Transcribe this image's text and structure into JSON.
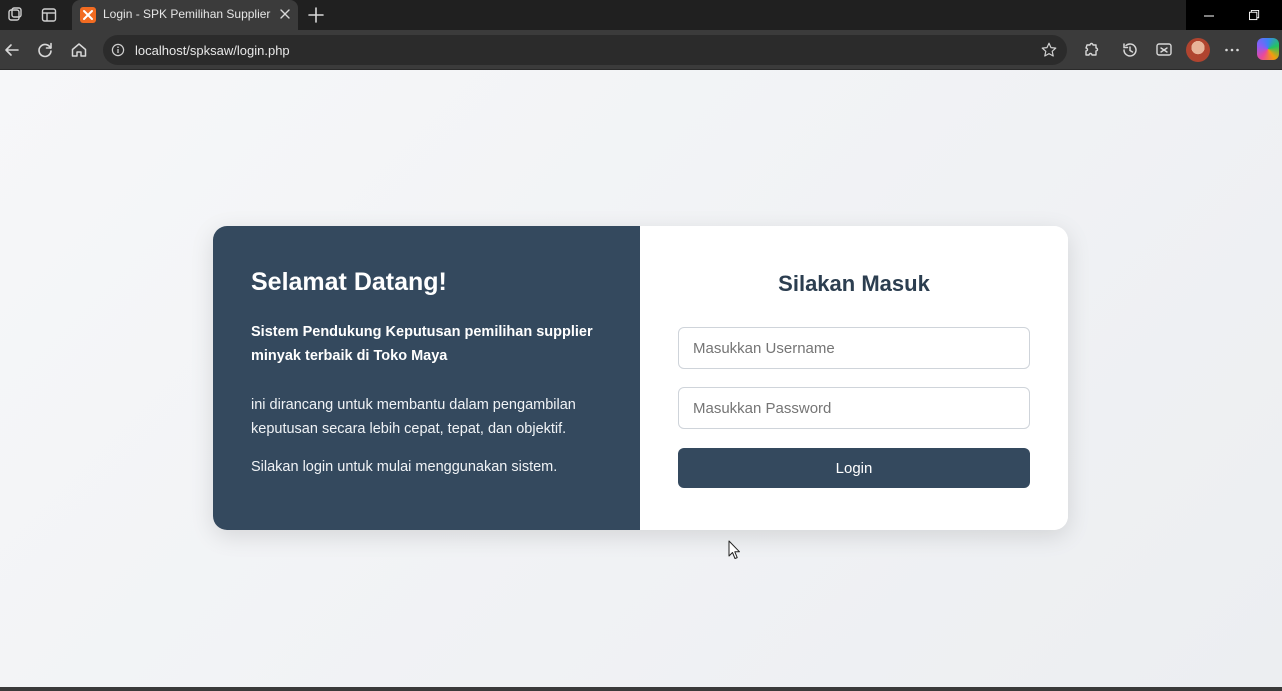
{
  "browser": {
    "tab_title": "Login - SPK Pemilihan Supplier",
    "url": "localhost/spksaw/login.php"
  },
  "login_panel": {
    "welcome_title": "Selamat Datang!",
    "subtitle": "Sistem Pendukung Keputusan pemilihan supplier minyak terbaik di Toko Maya",
    "description": "ini dirancang untuk membantu dalam pengambilan keputusan secara lebih cepat, tepat, dan objektif.",
    "instruction": "Silakan login untuk mulai menggunakan sistem."
  },
  "login_form": {
    "title": "Silakan Masuk",
    "username_placeholder": "Masukkan Username",
    "username_value": "",
    "password_placeholder": "Masukkan Password",
    "password_value": "",
    "login_label": "Login"
  },
  "colors": {
    "primary": "#34495e",
    "title_text": "#2c3e50",
    "page_background": "#f2f3f5"
  }
}
